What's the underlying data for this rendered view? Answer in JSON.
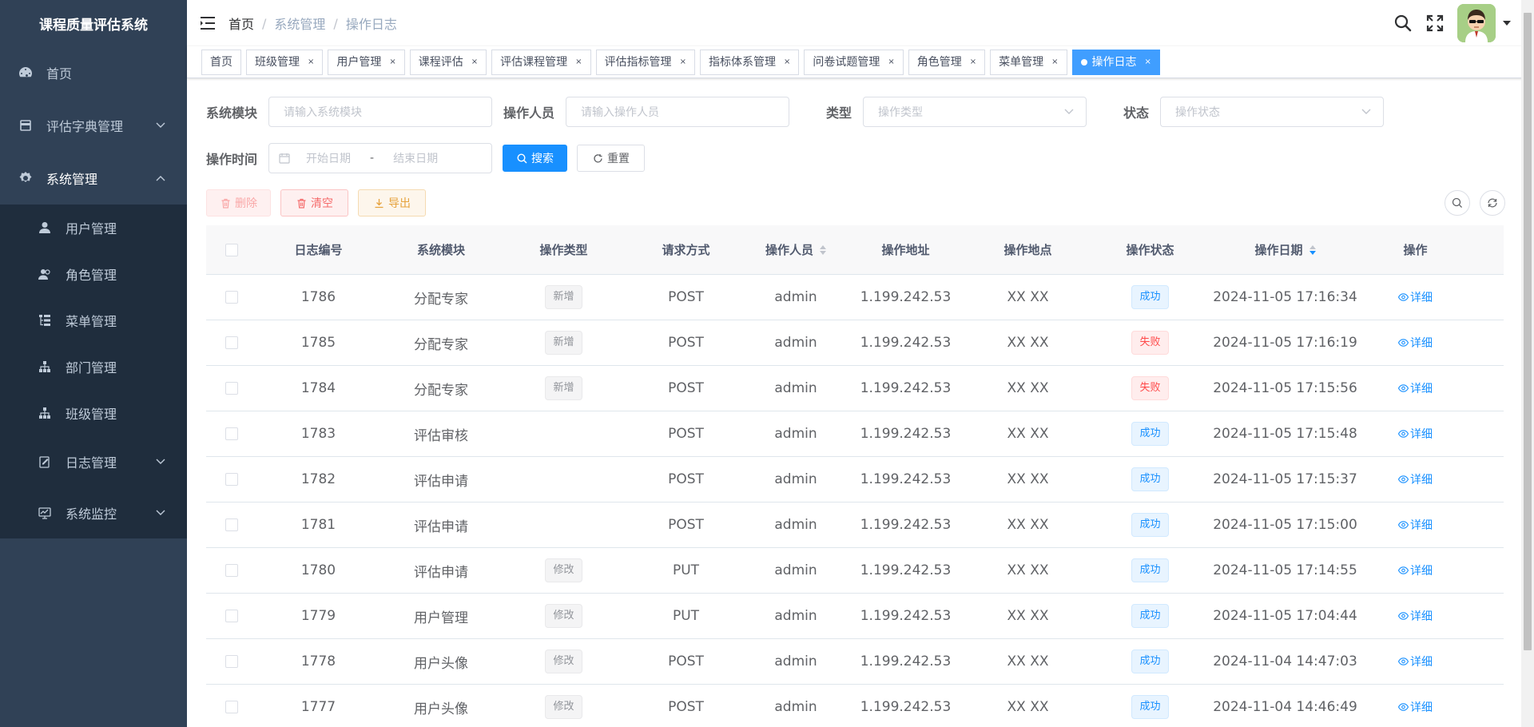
{
  "app": {
    "title": "课程质量评估系统"
  },
  "sidebar": {
    "items": [
      {
        "label": "首页",
        "icon": "dashboard-icon"
      },
      {
        "label": "评估字典管理",
        "icon": "dictionary-icon",
        "expandable": true
      },
      {
        "label": "系统管理",
        "icon": "gear-icon",
        "expandable": true,
        "expanded": true
      }
    ],
    "sub_items": [
      {
        "label": "用户管理",
        "icon": "user-icon"
      },
      {
        "label": "角色管理",
        "icon": "peoples-icon"
      },
      {
        "label": "菜单管理",
        "icon": "tree-table-icon"
      },
      {
        "label": "部门管理",
        "icon": "tree-icon"
      },
      {
        "label": "班级管理",
        "icon": "tree-icon"
      },
      {
        "label": "日志管理",
        "icon": "log-icon",
        "expandable": true
      },
      {
        "label": "系统监控",
        "icon": "monitor-icon",
        "expandable": true
      }
    ]
  },
  "header": {
    "breadcrumb": [
      "首页",
      "系统管理",
      "操作日志"
    ]
  },
  "tags": [
    {
      "label": "首页",
      "closable": false
    },
    {
      "label": "班级管理",
      "closable": true
    },
    {
      "label": "用户管理",
      "closable": true
    },
    {
      "label": "课程评估",
      "closable": true
    },
    {
      "label": "评估课程管理",
      "closable": true
    },
    {
      "label": "评估指标管理",
      "closable": true
    },
    {
      "label": "指标体系管理",
      "closable": true
    },
    {
      "label": "问卷试题管理",
      "closable": true
    },
    {
      "label": "角色管理",
      "closable": true
    },
    {
      "label": "菜单管理",
      "closable": true
    },
    {
      "label": "操作日志",
      "closable": true,
      "active": true
    }
  ],
  "tag_close": "×",
  "filters": {
    "module_label": "系统模块",
    "module_placeholder": "请输入系统模块",
    "operator_label": "操作人员",
    "operator_placeholder": "请输入操作人员",
    "type_label": "类型",
    "type_placeholder": "操作类型",
    "status_label": "状态",
    "status_placeholder": "操作状态",
    "time_label": "操作时间",
    "start_placeholder": "开始日期",
    "range_sep": "-",
    "end_placeholder": "结束日期",
    "search_label": "搜索",
    "reset_label": "重置"
  },
  "toolbar": {
    "delete_label": "删除",
    "clear_label": "清空",
    "export_label": "导出"
  },
  "table": {
    "columns": [
      "日志编号",
      "系统模块",
      "操作类型",
      "请求方式",
      "操作人员",
      "操作地址",
      "操作地点",
      "操作状态",
      "操作日期",
      "操作"
    ],
    "detail_label": "详细",
    "rows": [
      {
        "id": "1786",
        "module": "分配专家",
        "type": "新增",
        "method": "POST",
        "operator": "admin",
        "ip": "1.199.242.53",
        "location": "XX XX",
        "status": "成功",
        "status_kind": "success",
        "date": "2024-11-05 17:16:34"
      },
      {
        "id": "1785",
        "module": "分配专家",
        "type": "新增",
        "method": "POST",
        "operator": "admin",
        "ip": "1.199.242.53",
        "location": "XX XX",
        "status": "失败",
        "status_kind": "fail",
        "date": "2024-11-05 17:16:19"
      },
      {
        "id": "1784",
        "module": "分配专家",
        "type": "新增",
        "method": "POST",
        "operator": "admin",
        "ip": "1.199.242.53",
        "location": "XX XX",
        "status": "失败",
        "status_kind": "fail",
        "date": "2024-11-05 17:15:56"
      },
      {
        "id": "1783",
        "module": "评估审核",
        "type": "",
        "method": "POST",
        "operator": "admin",
        "ip": "1.199.242.53",
        "location": "XX XX",
        "status": "成功",
        "status_kind": "success",
        "date": "2024-11-05 17:15:48"
      },
      {
        "id": "1782",
        "module": "评估申请",
        "type": "",
        "method": "POST",
        "operator": "admin",
        "ip": "1.199.242.53",
        "location": "XX XX",
        "status": "成功",
        "status_kind": "success",
        "date": "2024-11-05 17:15:37"
      },
      {
        "id": "1781",
        "module": "评估申请",
        "type": "",
        "method": "POST",
        "operator": "admin",
        "ip": "1.199.242.53",
        "location": "XX XX",
        "status": "成功",
        "status_kind": "success",
        "date": "2024-11-05 17:15:00"
      },
      {
        "id": "1780",
        "module": "评估申请",
        "type": "修改",
        "method": "PUT",
        "operator": "admin",
        "ip": "1.199.242.53",
        "location": "XX XX",
        "status": "成功",
        "status_kind": "success",
        "date": "2024-11-05 17:14:55"
      },
      {
        "id": "1779",
        "module": "用户管理",
        "type": "修改",
        "method": "PUT",
        "operator": "admin",
        "ip": "1.199.242.53",
        "location": "XX XX",
        "status": "成功",
        "status_kind": "success",
        "date": "2024-11-05 17:04:44"
      },
      {
        "id": "1778",
        "module": "用户头像",
        "type": "修改",
        "method": "POST",
        "operator": "admin",
        "ip": "1.199.242.53",
        "location": "XX XX",
        "status": "成功",
        "status_kind": "success",
        "date": "2024-11-04 14:47:03"
      },
      {
        "id": "1777",
        "module": "用户头像",
        "type": "修改",
        "method": "POST",
        "operator": "admin",
        "ip": "1.199.242.53",
        "location": "XX XX",
        "status": "成功",
        "status_kind": "success",
        "date": "2024-11-04 14:46:49"
      }
    ]
  },
  "colors": {
    "sidebar_bg": "#304156",
    "submenu_bg": "#1f2d3d",
    "primary": "#1890ff",
    "active_tag": "#409eff",
    "danger": "#f56c6c",
    "warning": "#e6a23c"
  }
}
